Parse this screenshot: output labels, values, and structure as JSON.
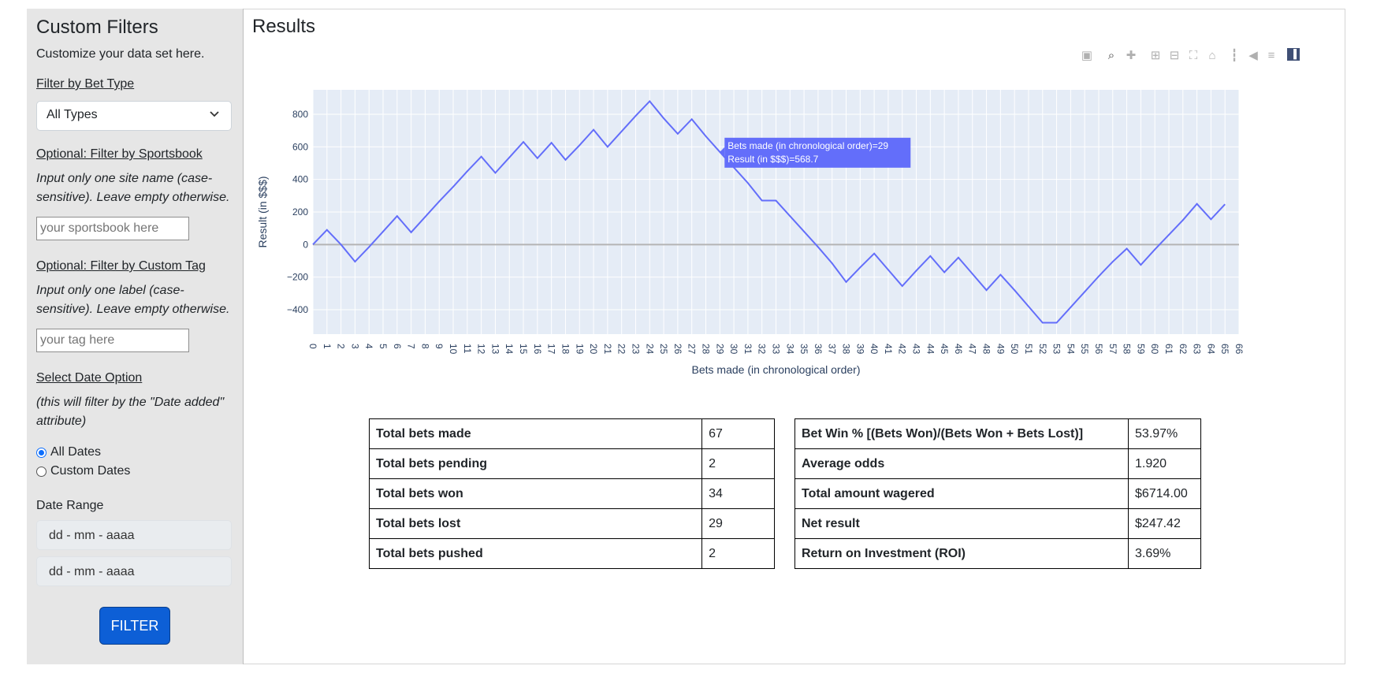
{
  "sidebar": {
    "title": "Custom Filters",
    "subtitle": "Customize your data set here.",
    "bet_type_label": "Filter by Bet Type",
    "bet_type_value": "All Types",
    "sportsbook_label": "Optional: Filter by Sportsbook",
    "sportsbook_help": "Input only one site name (case-sensitive). Leave empty otherwise.",
    "sportsbook_placeholder": "your sportsbook here",
    "tag_label": "Optional: Filter by Custom Tag",
    "tag_help": "Input only one label (case-sensitive). Leave empty otherwise.",
    "tag_placeholder": "your tag here",
    "date_option_label": "Select Date Option",
    "date_option_help": "(this will filter by the \"Date added\" attribute)",
    "radio_all": "All Dates",
    "radio_custom": "Custom Dates",
    "date_range_label": "Date Range",
    "date_start": "dd - mm - aaaa",
    "date_end": "dd - mm - aaaa",
    "filter_button": "FILTER"
  },
  "main": {
    "title": "Results"
  },
  "modebar": [
    "camera-icon",
    "zoom-icon",
    "pan-icon",
    "zoom-in-icon",
    "zoom-out-icon",
    "autoscale-icon",
    "reset-axes-icon",
    "spike-lines-icon",
    "hover-closest-icon",
    "hover-compare-icon",
    "plotly-logo-icon"
  ],
  "chart_data": {
    "type": "line",
    "xlabel": "Bets made (in chronological order)",
    "ylabel": "Result (in $$$)",
    "xlim": [
      0,
      66
    ],
    "ylim": [
      -550,
      950
    ],
    "yticks": [
      -400,
      -200,
      0,
      200,
      400,
      600,
      800
    ],
    "line_color": "#636efa",
    "x": [
      0,
      1,
      2,
      3,
      4,
      5,
      6,
      7,
      8,
      9,
      10,
      11,
      12,
      13,
      14,
      15,
      16,
      17,
      18,
      19,
      20,
      21,
      22,
      23,
      24,
      25,
      26,
      27,
      28,
      29,
      30,
      31,
      32,
      33,
      34,
      35,
      36,
      37,
      38,
      39,
      40,
      41,
      42,
      43,
      44,
      45,
      46,
      47,
      48,
      49,
      50,
      51,
      52,
      53,
      54,
      55,
      56,
      57,
      58,
      59,
      60,
      61,
      62,
      63,
      64,
      65
    ],
    "y": [
      0,
      90,
      0,
      -105,
      -15,
      80,
      175,
      75,
      170,
      265,
      355,
      450,
      540,
      440,
      535,
      630,
      530,
      625,
      520,
      610,
      705,
      600,
      695,
      790,
      880,
      775,
      680,
      770,
      665,
      568.7,
      473,
      378,
      270,
      270,
      175,
      80,
      -15,
      -115,
      -230,
      -140,
      -55,
      -155,
      -255,
      -160,
      -70,
      -170,
      -80,
      -180,
      -280,
      -185,
      -280,
      -380,
      -480,
      -480,
      -385,
      -290,
      -195,
      -105,
      -25,
      -125,
      -30,
      60,
      150,
      250,
      155,
      247.42
    ],
    "tooltip": {
      "line1": "Bets made (in chronological order)=29",
      "line2": "Result (in $$$)=568.7"
    }
  },
  "stats_left": [
    {
      "label": "Total bets made",
      "value": "67"
    },
    {
      "label": "Total bets pending",
      "value": "2"
    },
    {
      "label": "Total bets won",
      "value": "34"
    },
    {
      "label": "Total bets lost",
      "value": "29"
    },
    {
      "label": "Total bets pushed",
      "value": "2"
    }
  ],
  "stats_right": [
    {
      "label": "Bet Win % [(Bets Won)/(Bets Won + Bets Lost)]",
      "value": "53.97%"
    },
    {
      "label": "Average odds",
      "value": "1.920"
    },
    {
      "label": "Total amount wagered",
      "value": "$6714.00"
    },
    {
      "label": "Net result",
      "value": "$247.42"
    },
    {
      "label": "Return on Investment (ROI)",
      "value": "3.69%"
    }
  ]
}
